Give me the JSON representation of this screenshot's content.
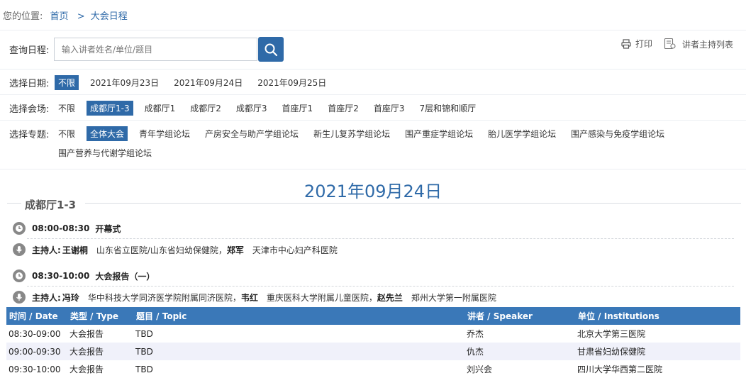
{
  "breadcrumb": {
    "prefix": "您的位置:",
    "home": "首页",
    "sep": ">",
    "current": "大会日程"
  },
  "query": {
    "label": "查询日程:",
    "placeholder": "输入讲者姓名/单位/题目"
  },
  "tools": {
    "print": "打印",
    "speakers": "讲者主持列表"
  },
  "filters": {
    "date": {
      "label": "选择日期:",
      "options": [
        "不限",
        "2021年09月23日",
        "2021年09月24日",
        "2021年09月25日"
      ]
    },
    "hall": {
      "label": "选择会场:",
      "options": [
        "不限",
        "成都厅1-3",
        "成都厅1",
        "成都厅2",
        "成都厅3",
        "首座厅1",
        "首座厅2",
        "首座厅3",
        "7层和锦和顺厅"
      ]
    },
    "topic": {
      "label": "选择专题:",
      "options": [
        "不限",
        "全体大会",
        "青年学组论坛",
        "产房安全与助产学组论坛",
        "新生儿复苏学组论坛",
        "围产重症学组论坛",
        "胎儿医学学组论坛",
        "围产感染与免疫学组论坛",
        "围产营养与代谢学组论坛"
      ]
    }
  },
  "schedule": {
    "date": "2021年09月24日",
    "hall": "成都厅1-3",
    "sessions": [
      {
        "time": "08:00-08:30",
        "title": "开幕式",
        "host_label": "主持人:",
        "hosts": [
          {
            "name": "王谢桐",
            "org": "山东省立医院/山东省妇幼保健院"
          },
          {
            "name": "郑军",
            "org": "天津市中心妇产科医院"
          }
        ]
      },
      {
        "time": "08:30-10:00",
        "title": "大会报告（一）",
        "host_label": "主持人:",
        "hosts": [
          {
            "name": "冯玲",
            "org": "华中科技大学同济医学院附属同济医院"
          },
          {
            "name": "韦红",
            "org": "重庆医科大学附属儿童医院"
          },
          {
            "name": "赵先兰",
            "org": "郑州大学第一附属医院"
          }
        ]
      }
    ]
  },
  "table": {
    "headers": [
      "时间 / Date",
      "类型 / Type",
      "题目 / Topic",
      "讲者 / Speaker",
      "单位 / Institutions"
    ],
    "rows": [
      [
        "08:30-09:00",
        "大会报告",
        "TBD",
        "乔杰",
        "北京大学第三医院"
      ],
      [
        "09:00-09:30",
        "大会报告",
        "TBD",
        "仇杰",
        "甘肃省妇幼保健院"
      ],
      [
        "09:30-10:00",
        "大会报告",
        "TBD",
        "刘兴会",
        "四川大学华西第二医院"
      ]
    ]
  },
  "colors": {
    "accent": "#2f6aa8",
    "table_header": "#3a78b8",
    "row_alt": "#f0f1fa"
  }
}
